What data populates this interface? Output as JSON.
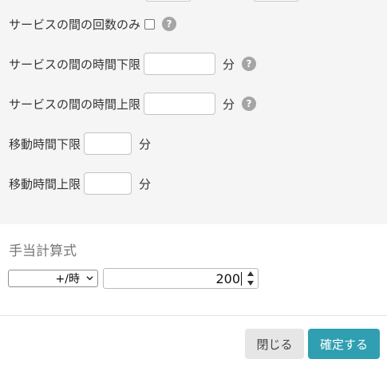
{
  "service_between": {
    "count_only_label": "サービスの間の回数のみ",
    "time_lower_label": "サービスの間の時間下限",
    "time_lower_value": "",
    "time_upper_label": "サービスの間の時間上限",
    "time_upper_value": "",
    "unit_minutes": "分",
    "help_symbol": "?"
  },
  "travel": {
    "time_lower_label": "移動時間下限",
    "time_lower_value": "",
    "time_upper_label": "移動時間上限",
    "time_upper_value": "",
    "unit_minutes": "分"
  },
  "allowance": {
    "title": "手当計算式",
    "unit_select": "+/時",
    "amount": "200"
  },
  "footer": {
    "close_label": "閉じる",
    "confirm_label": "確定する"
  },
  "colors": {
    "confirm_button": "#2f9fb1",
    "close_button": "#e6e6e6",
    "upper_section_bg": "#f5f5f5",
    "help_icon": "#a5a5a5"
  },
  "icons": {
    "help": "question-circle-icon",
    "select_arrow": "chevron-down-icon",
    "spinner": "up-down-arrows-icon"
  }
}
